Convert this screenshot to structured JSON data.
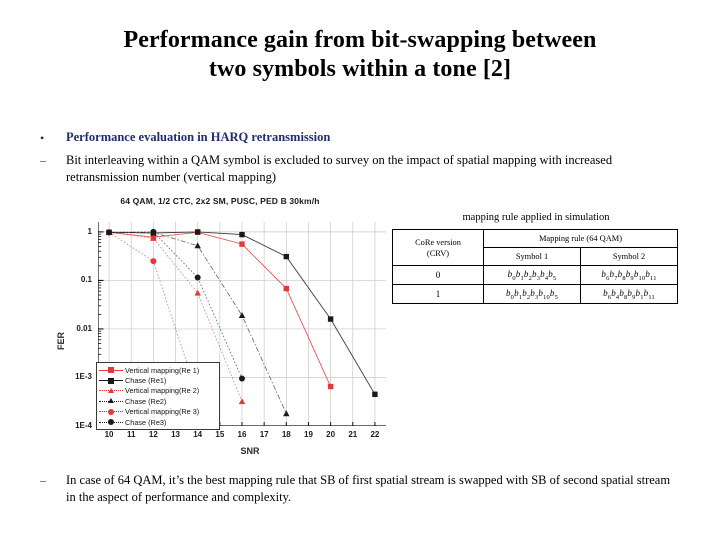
{
  "slide": {
    "title_line1": "Performance gain from bit-swapping between",
    "title_line2": "two symbols within a tone [2]",
    "accent_color": "#1F2C6E"
  },
  "bullets": {
    "level1_mark": "•",
    "level1_text": "Performance evaluation in HARQ retransmission",
    "level2_mark": "–",
    "level2a_text": "Bit interleaving within a QAM symbol is excluded to survey on the impact of spatial mapping with increased retransmission number (vertical mapping)",
    "level2b_text": "In case of 64 QAM, it’s the best mapping rule that SB of first spatial stream is swapped with SB of second spatial stream in the aspect of performance and complexity."
  },
  "chart_data": {
    "type": "line",
    "title": "64 QAM, 1/2 CTC, 2x2 SM, PUSC,  PED B 30km/h",
    "xlabel": "SNR",
    "ylabel": "FER",
    "yscale": "log",
    "xlim": [
      9.5,
      22.5
    ],
    "ylim": [
      0.0001,
      1.6
    ],
    "xticks": [
      10,
      11,
      12,
      13,
      14,
      15,
      16,
      17,
      18,
      19,
      20,
      21,
      22
    ],
    "ytick_values": [
      1,
      0.1,
      0.01,
      0.001,
      0.0001
    ],
    "ytick_labels": [
      "1",
      "0.1",
      "0.01",
      "1E-3",
      "1E-4"
    ],
    "grid": true,
    "legend_position": "lower-left",
    "series": [
      {
        "name": "Vertical mapping(Re 1)",
        "color": "#E03A3A",
        "marker": "square",
        "linestyle": "solid",
        "x": [
          10,
          12,
          14,
          16,
          18,
          20
        ],
        "y": [
          0.98,
          0.78,
          0.98,
          0.56,
          0.068,
          0.00065
        ]
      },
      {
        "name": "Chase (Re1)",
        "color": "#1A1A1A",
        "marker": "square",
        "linestyle": "solid",
        "x": [
          10,
          12,
          14,
          16,
          18,
          20,
          22
        ],
        "y": [
          0.98,
          0.95,
          1.0,
          0.88,
          0.31,
          0.016,
          0.00045
        ]
      },
      {
        "name": "Vertical mapping(Re 2)",
        "color": "#E03A3A",
        "marker": "triangle",
        "linestyle": "dotted",
        "x": [
          10,
          12,
          14,
          16
        ],
        "y": [
          0.98,
          0.74,
          0.055,
          0.00032
        ]
      },
      {
        "name": "Chase (Re2)",
        "color": "#1A1A1A",
        "marker": "triangle",
        "linestyle": "dashdot",
        "x": [
          10,
          12,
          14,
          16,
          18
        ],
        "y": [
          0.98,
          0.97,
          0.52,
          0.019,
          0.00018
        ]
      },
      {
        "name": "Vertical mapping(Re 3)",
        "color": "#E03A3A",
        "marker": "circle",
        "linestyle": "dotted",
        "x": [
          10,
          12,
          14
        ],
        "y": [
          0.98,
          0.25,
          0.00042
        ]
      },
      {
        "name": "Chase (Re3)",
        "color": "#1A1A1A",
        "marker": "circle",
        "linestyle": "dotted",
        "x": [
          10,
          12,
          14,
          16
        ],
        "y": [
          0.98,
          1.0,
          0.115,
          0.00095
        ]
      }
    ]
  },
  "table": {
    "caption": "mapping rule  applied in simulation",
    "head_crv_line1": "CoRe version",
    "head_crv_line2": "(CRV)",
    "head_rule": "Mapping rule (64 QAM)",
    "head_sym1": "Symbol 1",
    "head_sym2": "Symbol 2",
    "rows": [
      {
        "crv": "0",
        "sym1": [
          [
            "b",
            "0"
          ],
          [
            "b",
            "1"
          ],
          [
            "b",
            "2"
          ],
          [
            "b",
            "3"
          ],
          [
            "b",
            "4"
          ],
          [
            "b",
            "5"
          ]
        ],
        "sym2": [
          [
            "b",
            "6"
          ],
          [
            "b",
            "7"
          ],
          [
            "b",
            "8"
          ],
          [
            "b",
            "9"
          ],
          [
            "b",
            "10"
          ],
          [
            "b",
            "11"
          ]
        ]
      },
      {
        "crv": "1",
        "sym1": [
          [
            "b",
            "0"
          ],
          [
            "b",
            "1"
          ],
          [
            "b",
            "2"
          ],
          [
            "b",
            "3"
          ],
          [
            "b",
            "10"
          ],
          [
            "b",
            "5"
          ]
        ],
        "sym2": [
          [
            "b",
            "6"
          ],
          [
            "b",
            "4"
          ],
          [
            "b",
            "8"
          ],
          [
            "b",
            "9"
          ],
          [
            "b",
            "1"
          ],
          [
            "b",
            "11"
          ]
        ]
      }
    ]
  }
}
